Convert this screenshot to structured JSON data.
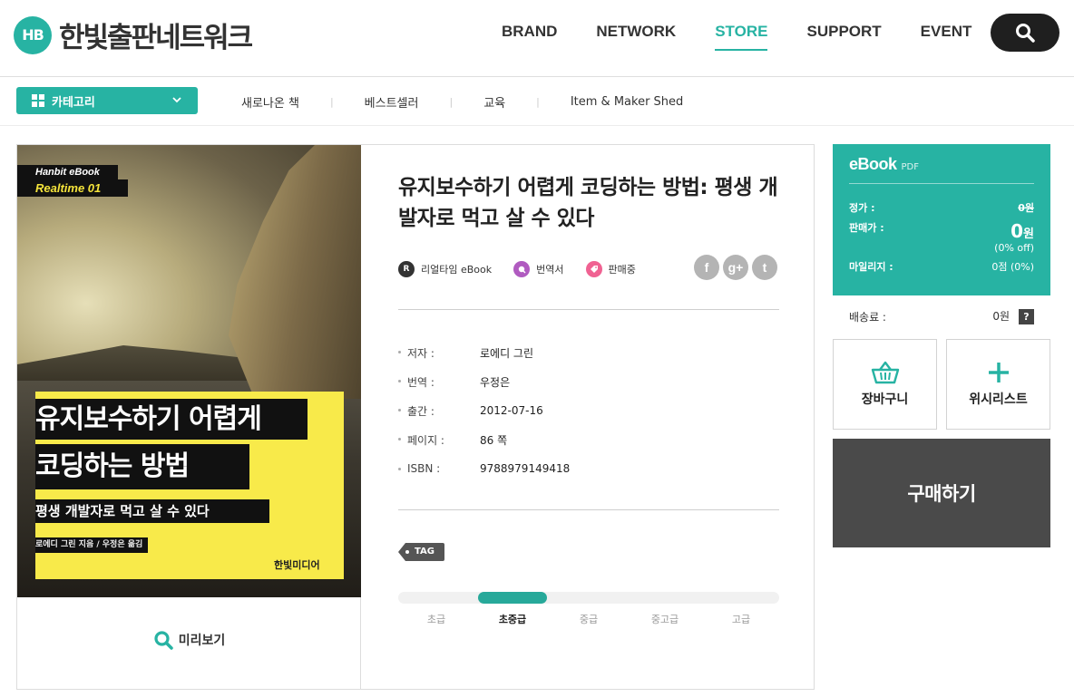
{
  "brand": {
    "logo_mark": "HB",
    "name": "한빛출판네트워크"
  },
  "gnb": [
    {
      "label": "BRAND",
      "active": false
    },
    {
      "label": "NETWORK",
      "active": false
    },
    {
      "label": "STORE",
      "active": true
    },
    {
      "label": "SUPPORT",
      "active": false
    },
    {
      "label": "EVENT",
      "active": false
    }
  ],
  "subnav": {
    "category_label": "카테고리",
    "links": [
      "새로나온 책",
      "베스트셀러",
      "교육",
      "Item & Maker Shed"
    ],
    "separator": "|"
  },
  "cover": {
    "series_line1": "Hanbit eBook",
    "series_line2": "Realtime 01",
    "title_line1": "유지보수하기 어렵게",
    "title_line2": "코딩하는 방법",
    "subtitle": "평생 개발자로 먹고 살 수 있다",
    "credits": "로에디 그린 지음 / 우정은 옮김",
    "publisher": "한빛미디어"
  },
  "preview_label": "미리보기",
  "book": {
    "title": "유지보수하기 어렵게 코딩하는 방법: 평생 개발자로 먹고 살 수 있다",
    "badges": [
      {
        "icon_text": "R",
        "label": "리얼타임 eBook",
        "color": "#333333"
      },
      {
        "icon_text": "",
        "label": "번역서",
        "color": "#b05bc0"
      },
      {
        "icon_text": "",
        "label": "판매중",
        "color": "#f06292"
      }
    ],
    "social": [
      "f",
      "g+",
      "t"
    ],
    "meta": [
      {
        "key": "저자 :",
        "value": "로에디 그린"
      },
      {
        "key": "번역 :",
        "value": "우정은"
      },
      {
        "key": "출간 :",
        "value": "2012-07-16"
      },
      {
        "key": "페이지 :",
        "value": "86 쪽"
      },
      {
        "key": "ISBN :",
        "value": "9788979149418"
      }
    ],
    "tag_label": "TAG",
    "levels": [
      "초급",
      "초중급",
      "중급",
      "중고급",
      "고급"
    ],
    "level_selected_index": 1
  },
  "price": {
    "format": "eBook",
    "format_sub": "PDF",
    "list_price_label": "정가 :",
    "list_price": "0원",
    "sale_price_label": "판매가 :",
    "sale_price_num": "0",
    "sale_price_unit": "원",
    "discount": "(0% off)",
    "mileage_label": "마일리지 :",
    "mileage": "0점 (0%)",
    "shipping_label": "배송료 :",
    "shipping": "0원",
    "help": "?"
  },
  "actions": {
    "cart": "장바구니",
    "wishlist": "위시리스트",
    "buy": "구매하기"
  },
  "colors": {
    "accent": "#27b3a3",
    "buy_bg": "#4a4a4a"
  }
}
